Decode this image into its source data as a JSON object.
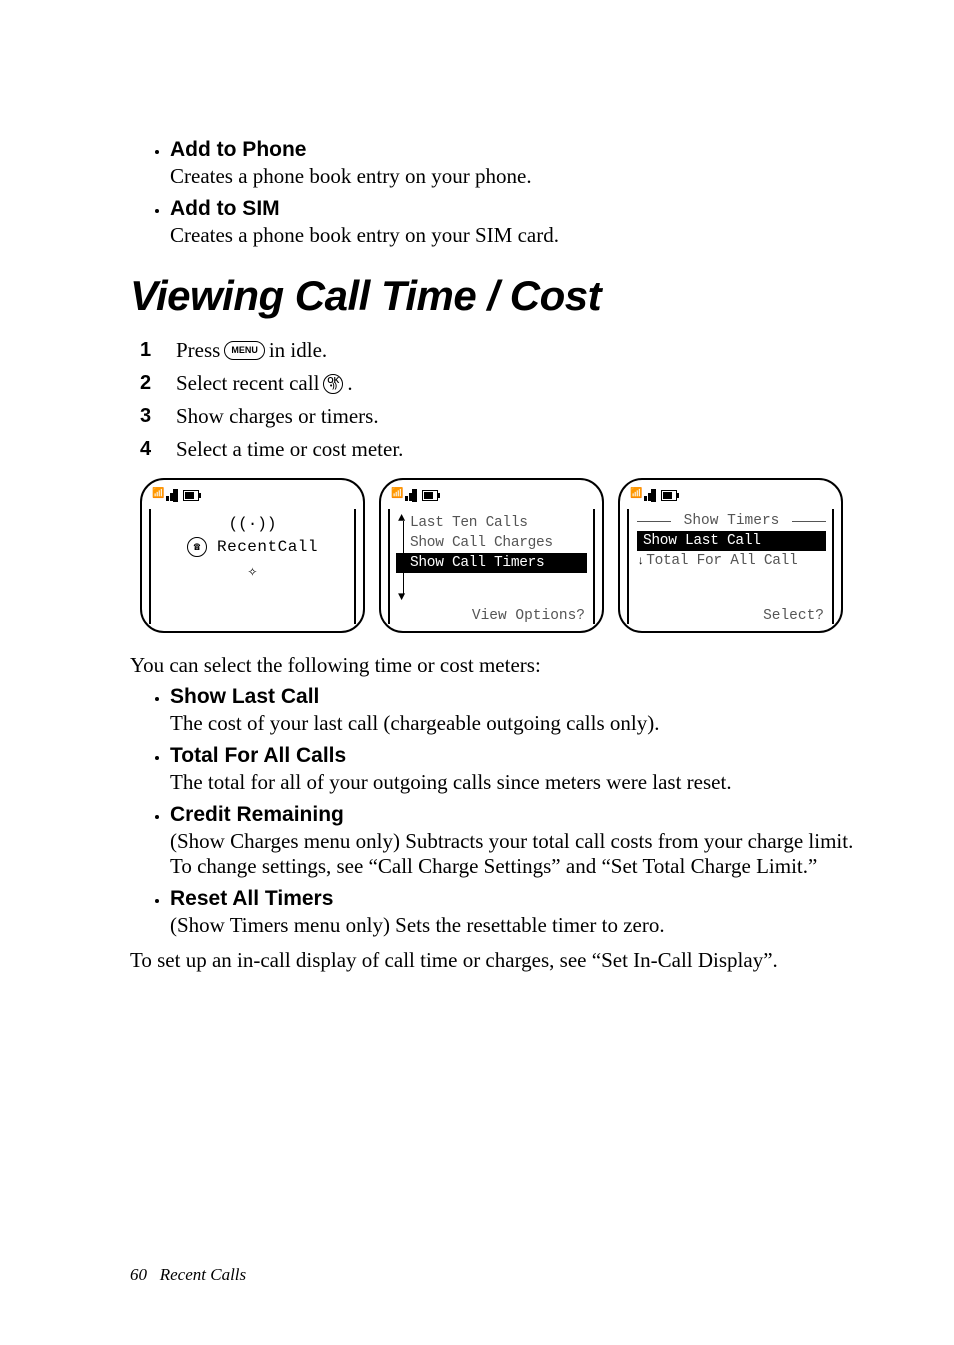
{
  "top_bullets": [
    {
      "title": "Add to Phone",
      "desc": "Creates a phone book entry on your phone."
    },
    {
      "title": "Add to SIM",
      "desc": "Creates a phone book entry on your SIM card."
    }
  ],
  "section_title": "Viewing Call Time / Cost",
  "steps": [
    {
      "n": "1",
      "before": "Press ",
      "key": "MENU",
      "after": " in idle."
    },
    {
      "n": "2",
      "before": "Select recent call ",
      "key": "OK",
      "after": "."
    },
    {
      "n": "3",
      "before": "Show charges or timers.",
      "key": "",
      "after": ""
    },
    {
      "n": "4",
      "before": "Select a time or cost meter.",
      "key": "",
      "after": ""
    }
  ],
  "phone1": {
    "label": "RecentCall"
  },
  "phone2": {
    "rows": [
      "Last Ten Calls",
      "Show Call Charges",
      "Show Call Timers"
    ],
    "hl_index": 2,
    "prompt": "View Options?"
  },
  "phone3": {
    "header": "Show Timers",
    "rows": [
      "Show Last Call",
      "Total For All Call"
    ],
    "hl_index": 0,
    "prompt": "Select?"
  },
  "meters_intro": "You can select the following time or cost meters:",
  "meters": [
    {
      "title": "Show Last Call",
      "desc": "The cost of your last call (chargeable outgoing calls only)."
    },
    {
      "title": "Total For All Calls",
      "desc": "The total for all of your outgoing calls since meters were last reset."
    },
    {
      "title": "Credit Remaining",
      "desc": "(Show Charges menu only) Subtracts your total call costs from your charge limit. To change settings, see “Call Charge Settings” and “Set Total Charge Limit.”"
    },
    {
      "title": "Reset All Timers",
      "desc": "(Show Timers menu only) Sets the resettable timer to zero."
    }
  ],
  "closing": "To set up an in-call display of call time or charges, see “Set In-Call Display”.",
  "footer_page": "60",
  "footer_section": "Recent Calls"
}
